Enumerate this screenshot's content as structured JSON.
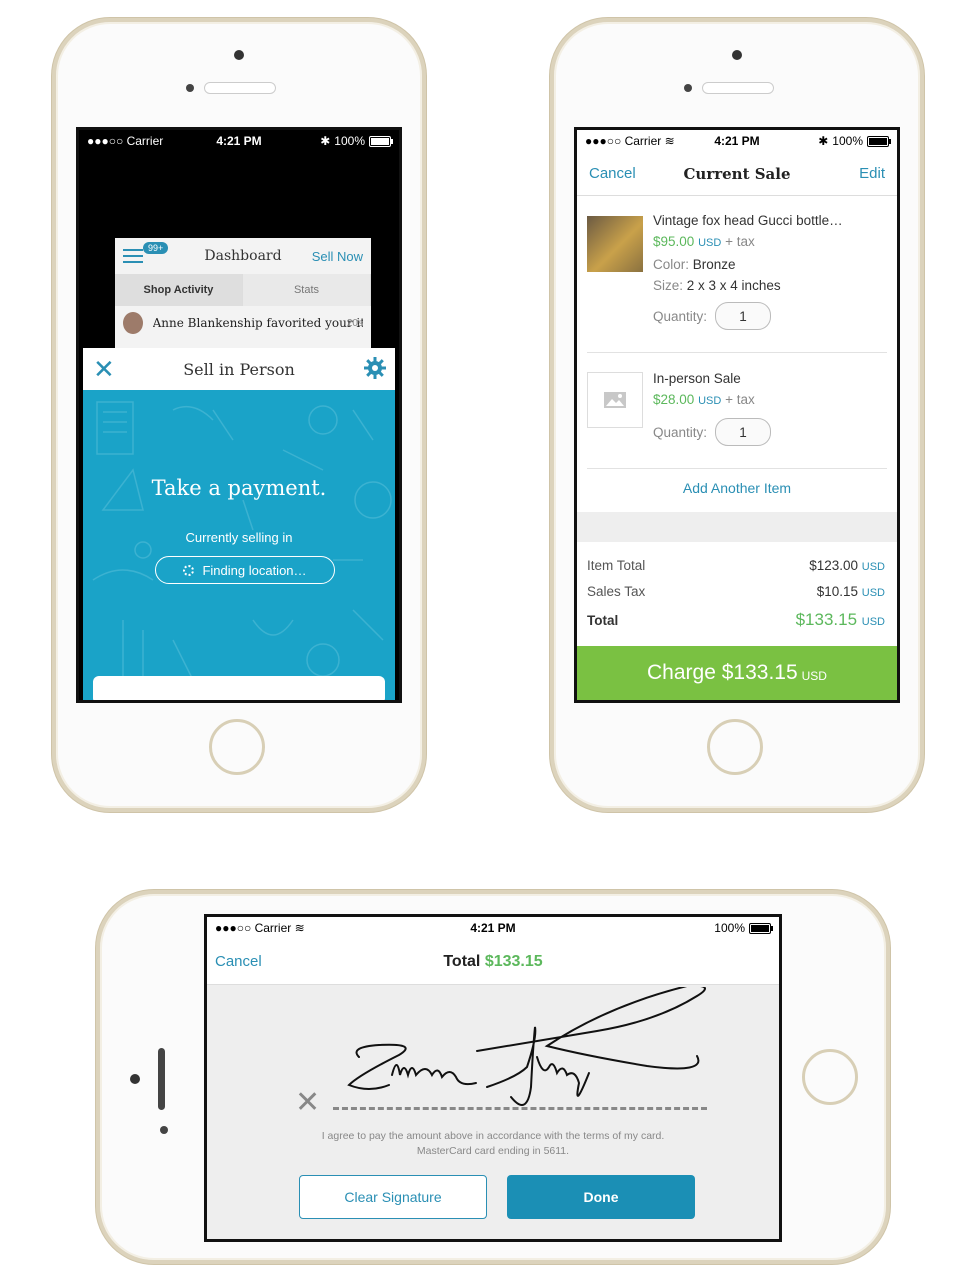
{
  "status": {
    "carrier": "Carrier",
    "time": "4:21 PM",
    "battery": "100%"
  },
  "phone1": {
    "dashboard": {
      "badge": "99+",
      "title": "Dashboard",
      "sell_now": "Sell Now",
      "tabs": [
        "Shop Activity",
        "Stats"
      ],
      "activity": {
        "text": "Anne Blankenship favorited your item!",
        "age": "20s"
      }
    },
    "sheet": {
      "title": "Sell in Person",
      "headline": "Take a payment.",
      "subline": "Currently selling in",
      "location_button": "Finding location…"
    }
  },
  "phone2": {
    "nav": {
      "cancel": "Cancel",
      "title": "Current Sale",
      "edit": "Edit"
    },
    "items": [
      {
        "name": "Vintage fox head Gucci bottle…",
        "price": "$95.00",
        "currency": "USD",
        "tax": "+ tax",
        "color_label": "Color:",
        "color": "Bronze",
        "size_label": "Size:",
        "size": "2 x 3 x 4 inches",
        "qty_label": "Quantity:",
        "qty": "1"
      },
      {
        "name": "In-person Sale",
        "price": "$28.00",
        "currency": "USD",
        "tax": "+ tax",
        "qty_label": "Quantity:",
        "qty": "1"
      }
    ],
    "add_item": "Add Another Item",
    "totals": [
      {
        "label": "Item Total",
        "value": "$123.00",
        "currency": "USD"
      },
      {
        "label": "Sales Tax",
        "value": "$10.15",
        "currency": "USD"
      },
      {
        "label": "Total",
        "value": "$133.15",
        "currency": "USD"
      }
    ],
    "charge": {
      "label": "Charge $133.15",
      "currency": "USD"
    }
  },
  "phone3": {
    "cancel": "Cancel",
    "total_label": "Total",
    "total_value": "$133.15",
    "signature_name": "Simone Jung",
    "agree_line1": "I agree to pay the amount above in accordance with the terms of my card.",
    "agree_line2": "MasterCard card ending in 5611.",
    "clear": "Clear Signature",
    "done": "Done"
  },
  "colors": {
    "accent": "#2a8fb4",
    "green": "#7ac142",
    "teal": "#1aa3c8"
  }
}
